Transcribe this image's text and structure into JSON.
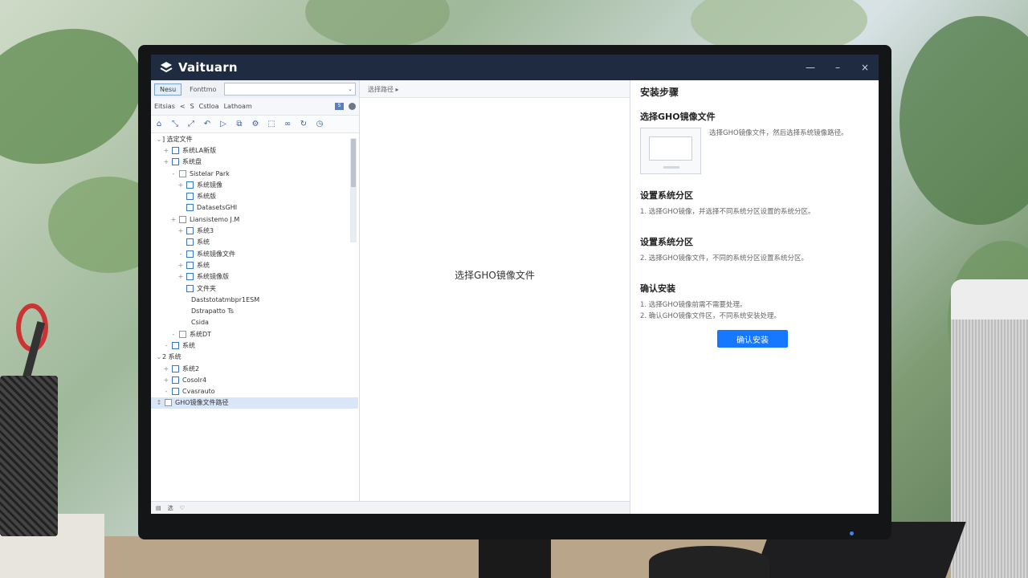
{
  "window": {
    "title": "Vaituarn",
    "controls": [
      "—",
      "–",
      "×"
    ]
  },
  "left_panel": {
    "tabs": [
      "Nesu",
      "Fonttmo"
    ],
    "combo_arrow": "⌄",
    "toolbar2": [
      "Eitsias",
      "<",
      "S",
      "Cstloa",
      "Lathoam"
    ],
    "toolbar2_badge": "S",
    "tree": [
      {
        "indent": 0,
        "exp": "⌄",
        "cb": false,
        "label": "]  选定文件"
      },
      {
        "indent": 1,
        "exp": "+",
        "cb": true,
        "label": "系统LA新版"
      },
      {
        "indent": 1,
        "exp": "+",
        "cb": true,
        "label": "系统盘"
      },
      {
        "indent": 2,
        "exp": "-",
        "cb": true,
        "label": "Sistelar Park"
      },
      {
        "indent": 3,
        "exp": "+",
        "cb": true,
        "label": "系统镜像"
      },
      {
        "indent": 3,
        "exp": "",
        "cb": true,
        "label": "系统版"
      },
      {
        "indent": 3,
        "exp": "",
        "cb": true,
        "label": "DatasetsGHI"
      },
      {
        "indent": 2,
        "exp": "+",
        "cb": true,
        "label": "Liansistemo J.M"
      },
      {
        "indent": 3,
        "exp": "+",
        "cb": true,
        "label": "系统3"
      },
      {
        "indent": 3,
        "exp": "",
        "cb": true,
        "label": "系统"
      },
      {
        "indent": 3,
        "exp": "-",
        "cb": true,
        "label": "系统镜像文件"
      },
      {
        "indent": 3,
        "exp": "+",
        "cb": true,
        "label": "系统"
      },
      {
        "indent": 3,
        "exp": "+",
        "cb": true,
        "label": "系统镜像版"
      },
      {
        "indent": 3,
        "exp": "",
        "cb": true,
        "label": "文件夹"
      },
      {
        "indent": 4,
        "exp": "",
        "cb": false,
        "label": "Daststotatmbpr1ESM"
      },
      {
        "indent": 4,
        "exp": "",
        "cb": false,
        "label": "Dstrapatto Ts"
      },
      {
        "indent": 4,
        "exp": "",
        "cb": false,
        "label": "Csida"
      },
      {
        "indent": 2,
        "exp": "-",
        "cb": true,
        "label": "系统DT"
      },
      {
        "indent": 1,
        "exp": "-",
        "cb": true,
        "label": "系统"
      },
      {
        "indent": 0,
        "exp": "⌄",
        "cb": false,
        "label": "2  系统"
      },
      {
        "indent": 1,
        "exp": "+",
        "cb": true,
        "label": "系统2"
      },
      {
        "indent": 1,
        "exp": "+",
        "cb": true,
        "label": "Cosolr4"
      },
      {
        "indent": 1,
        "exp": "-",
        "cb": true,
        "label": "Cvasrauto"
      },
      {
        "indent": 0,
        "exp": "↕",
        "cb": true,
        "label": "GHO镜像文件路径",
        "selected": true
      }
    ],
    "status": [
      "▤",
      "选",
      "♡"
    ]
  },
  "middle": {
    "breadcrumb": "选择路径 ▸",
    "placeholder_text": "选择GHO镜像文件"
  },
  "right_panel": {
    "title": "安装步骤",
    "step1": {
      "heading": "选择GHO镜像文件",
      "text": "选择GHO镜像文件，然后选择系统镜像路径。"
    },
    "step2": {
      "heading": "设置系统分区",
      "text": "1. 选择GHO镜像，并选择不同系统分区设置的系统分区。"
    },
    "step3": {
      "heading": "设置系统分区",
      "text": "2. 选择GHO镜像文件，不同的系统分区设置系统分区。"
    },
    "step4": {
      "heading": "确认安装",
      "lines": [
        "1. 选择GHO镜像前需不需要处理。",
        "2. 确认GHO镜像文件区，不同系统安装处理。"
      ]
    },
    "confirm_button": "确认安装"
  },
  "colors": {
    "titlebar": "#1e2b40",
    "accent": "#1677ff",
    "selected_row": "#d9e6f7"
  }
}
